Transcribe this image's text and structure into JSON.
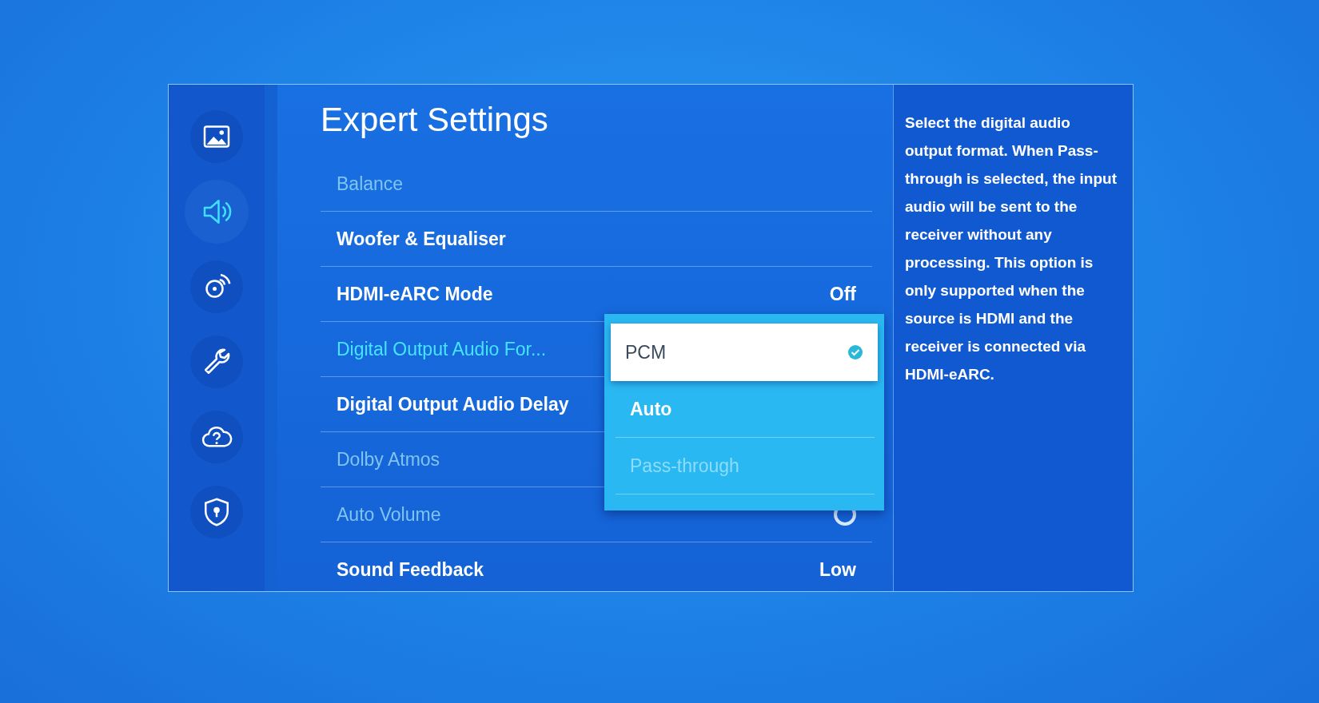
{
  "sidebar": {
    "items": [
      {
        "kind": "picture",
        "selected": false
      },
      {
        "kind": "sound",
        "selected": true
      },
      {
        "kind": "broadcast",
        "selected": false
      },
      {
        "kind": "support",
        "selected": false
      },
      {
        "kind": "cloud",
        "selected": false
      },
      {
        "kind": "privacy",
        "selected": false
      }
    ]
  },
  "title": "Expert Settings",
  "rows": [
    {
      "kind": "plain",
      "label": "Balance",
      "disabled": true,
      "selected": false
    },
    {
      "kind": "plain",
      "label": "Woofer & Equaliser",
      "disabled": false,
      "selected": false
    },
    {
      "kind": "value",
      "label": "HDMI-eARC Mode",
      "value": "Off",
      "disabled": false,
      "selected": false
    },
    {
      "kind": "plain",
      "label": "Digital Output Audio For...",
      "disabled": false,
      "selected": true
    },
    {
      "kind": "plain",
      "label": "Digital Output Audio Delay",
      "disabled": false,
      "selected": false
    },
    {
      "kind": "plain",
      "label": "Dolby Atmos",
      "disabled": true,
      "selected": false
    },
    {
      "kind": "toggle",
      "label": "Auto Volume",
      "disabled": true,
      "selected": false,
      "on": false
    },
    {
      "kind": "value",
      "label": "Sound Feedback",
      "value": "Low",
      "disabled": false,
      "selected": false
    }
  ],
  "dropdown": {
    "options": [
      {
        "label": "PCM",
        "selected": true,
        "disabled": false
      },
      {
        "label": "Auto",
        "selected": false,
        "disabled": false
      },
      {
        "label": "Pass-through",
        "selected": false,
        "disabled": true
      }
    ]
  },
  "help": "Select the digital audio output format. When Pass-through is selected, the input audio will be sent to the receiver without any processing. This option is only supported when the source is HDMI and the receiver is connected via HDMI-eARC."
}
